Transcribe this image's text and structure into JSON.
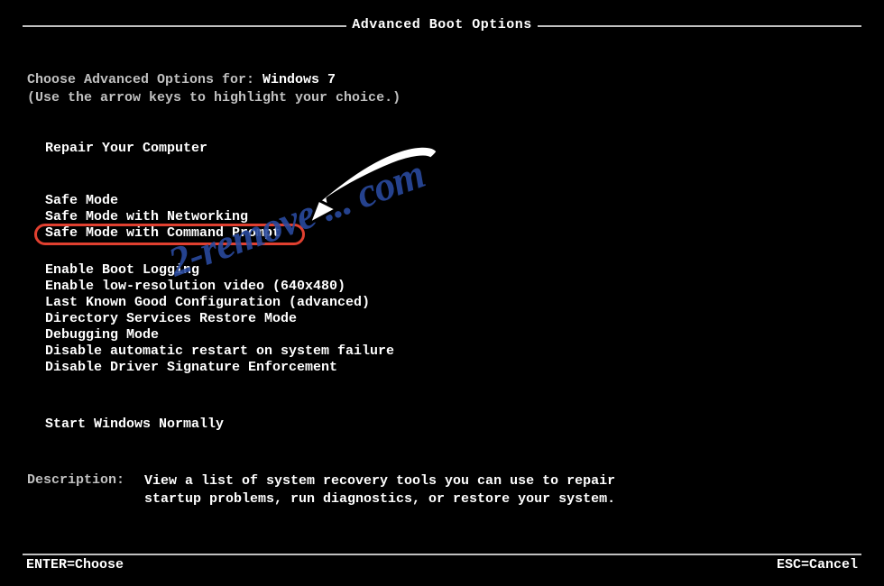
{
  "header": {
    "title": "Advanced Boot Options"
  },
  "prompt": {
    "prefix": "Choose Advanced Options for: ",
    "os": "Windows 7",
    "hint": "(Use the arrow keys to highlight your choice.)"
  },
  "group1": {
    "repair": "Repair Your Computer"
  },
  "group2": {
    "safe": "Safe Mode",
    "safenet": "Safe Mode with Networking",
    "safecmd": "Safe Mode with Command Prompt"
  },
  "group3": {
    "bootlog": "Enable Boot Logging",
    "lowres": "Enable low-resolution video (640x480)",
    "lkgc": "Last Known Good Configuration (advanced)",
    "dsrm": "Directory Services Restore Mode",
    "debug": "Debugging Mode",
    "norestart": "Disable automatic restart on system failure",
    "nosig": "Disable Driver Signature Enforcement"
  },
  "group4": {
    "normal": "Start Windows Normally"
  },
  "description": {
    "label": "Description:",
    "text": "View a list of system recovery tools you can use to repair startup problems, run diagnostics, or restore your system."
  },
  "footer": {
    "enter": "ENTER=Choose",
    "esc": "ESC=Cancel"
  },
  "watermark": "2-remove ... com"
}
